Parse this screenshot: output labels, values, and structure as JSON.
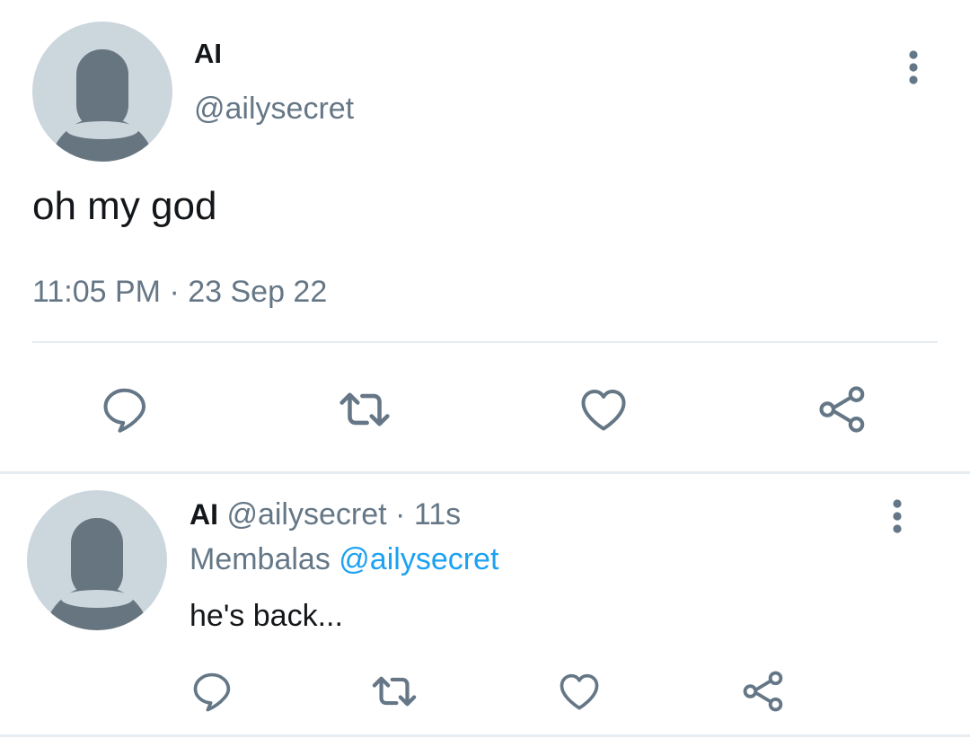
{
  "tweet": {
    "author_name": "AI",
    "author_handle": "@ailysecret",
    "text": "oh my god",
    "timestamp": "11:05 PM · 23 Sep 22",
    "avatar_icon": "default-profile-avatar",
    "more_icon": "more-vertical-icon",
    "actions": {
      "reply_icon": "reply-icon",
      "retweet_icon": "retweet-icon",
      "like_icon": "like-icon",
      "share_icon": "share-icon"
    }
  },
  "reply": {
    "author_name": "AI",
    "author_handle": "@ailysecret",
    "separator": "·",
    "time_ago": "11s",
    "replying_to_prefix": "Membalas",
    "replying_to_handle": "@ailysecret",
    "text": "he's back...",
    "avatar_icon": "default-profile-avatar",
    "more_icon": "more-vertical-icon"
  },
  "colors": {
    "primary_text": "#14171a",
    "secondary_text": "#657786",
    "link": "#1da1f2",
    "divider": "#e6ecf0",
    "avatar_bg": "#ccd6dd",
    "avatar_fg": "#66757f"
  }
}
